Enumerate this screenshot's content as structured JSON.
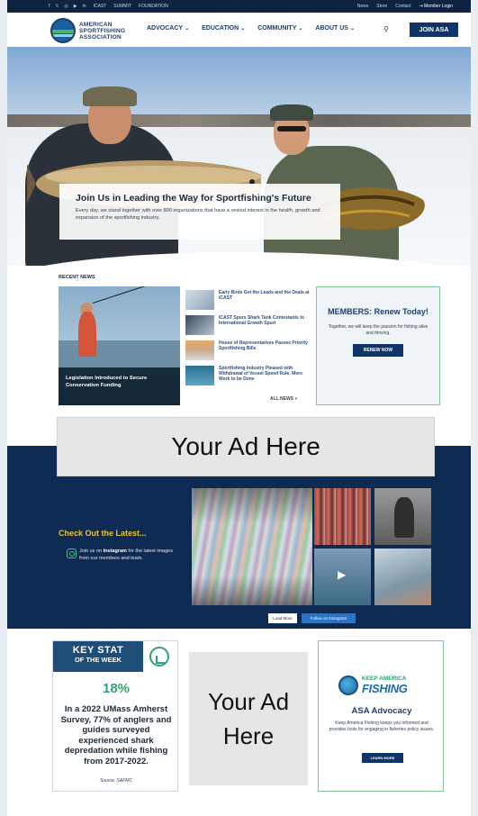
{
  "topbar": {
    "social": [
      "f",
      "𝕏",
      "◎",
      "▶",
      "in"
    ],
    "links": [
      "ICAST",
      "SUMMIT",
      "FOUNDATION"
    ],
    "right_links": [
      "News",
      "Store",
      "Contact"
    ],
    "member_login": "⇥ Member Login"
  },
  "header": {
    "logo_text": "AMERICAN SPORTFISHING ASSOCIATION",
    "nav": [
      {
        "label": "ADVOCACY"
      },
      {
        "label": "EDUCATION"
      },
      {
        "label": "COMMUNITY"
      },
      {
        "label": "ABOUT US"
      }
    ],
    "caret": "⌄",
    "search_glyph": "⚲",
    "join_label": "JOIN ASA"
  },
  "hero": {
    "title": "Join Us in Leading the Way for Sportfishing's Future",
    "subtitle": "Every day, we stand together with over 800 organizations that have a vested interest in the health, growth and expansion of the sportfishing industry."
  },
  "recent_news": {
    "label": "RECENT NEWS",
    "feature_caption": "Legislation Introduced to Secure Conservation Funding",
    "items": [
      {
        "title": "Early Birds Get the Leads and the Deals at ICAST"
      },
      {
        "title": "ICAST Spurs Shark Tank Contestants to International Growth Spurt"
      },
      {
        "title": "House of Representatives Passes Priority Sportfishing Bills"
      },
      {
        "title": "Sportfishing Industry Pleased with Withdrawal of Vessel Speed Rule, More Work to be Done"
      }
    ],
    "all_news": "ALL NEWS »"
  },
  "members": {
    "title": "MEMBERS: Renew Today!",
    "text": "Together, we will keep the passion for fishing alive and thriving.",
    "button": "RENEW NOW"
  },
  "ad_banner": {
    "text": "Your Ad Here"
  },
  "instagram": {
    "title": "Check Out the Latest...",
    "text_pre": "Join us on ",
    "text_bold": "Instagram",
    "text_post": " for the latest images from our members and team.",
    "load_more": "Load More",
    "follow": "Follow on Instagram"
  },
  "key_stat": {
    "header_line1": "KEY STAT",
    "header_line2": "OF THE WEEK",
    "percent": "18%",
    "text": "In a 2022 UMass Amherst Survey, 77% of anglers and guides surveyed experienced shark depredation while fishing from 2017-2022.",
    "source": "Source: SAFMC"
  },
  "ad_square": {
    "text": "Your Ad Here"
  },
  "advocacy": {
    "logo_line1": "KEEP AMERICA",
    "logo_line2": "FISHING",
    "title": "ASA Advocacy",
    "text": "Keep America Fishing keeps you informed and provides tools for engaging in fisheries policy issues.",
    "button": "LEARN MORE"
  },
  "colors": {
    "navy": "#0f3468",
    "dark_navy": "#0d2a52",
    "green": "#2fa36d",
    "gold": "#e9c23b",
    "link_blue": "#1f4f8a"
  }
}
